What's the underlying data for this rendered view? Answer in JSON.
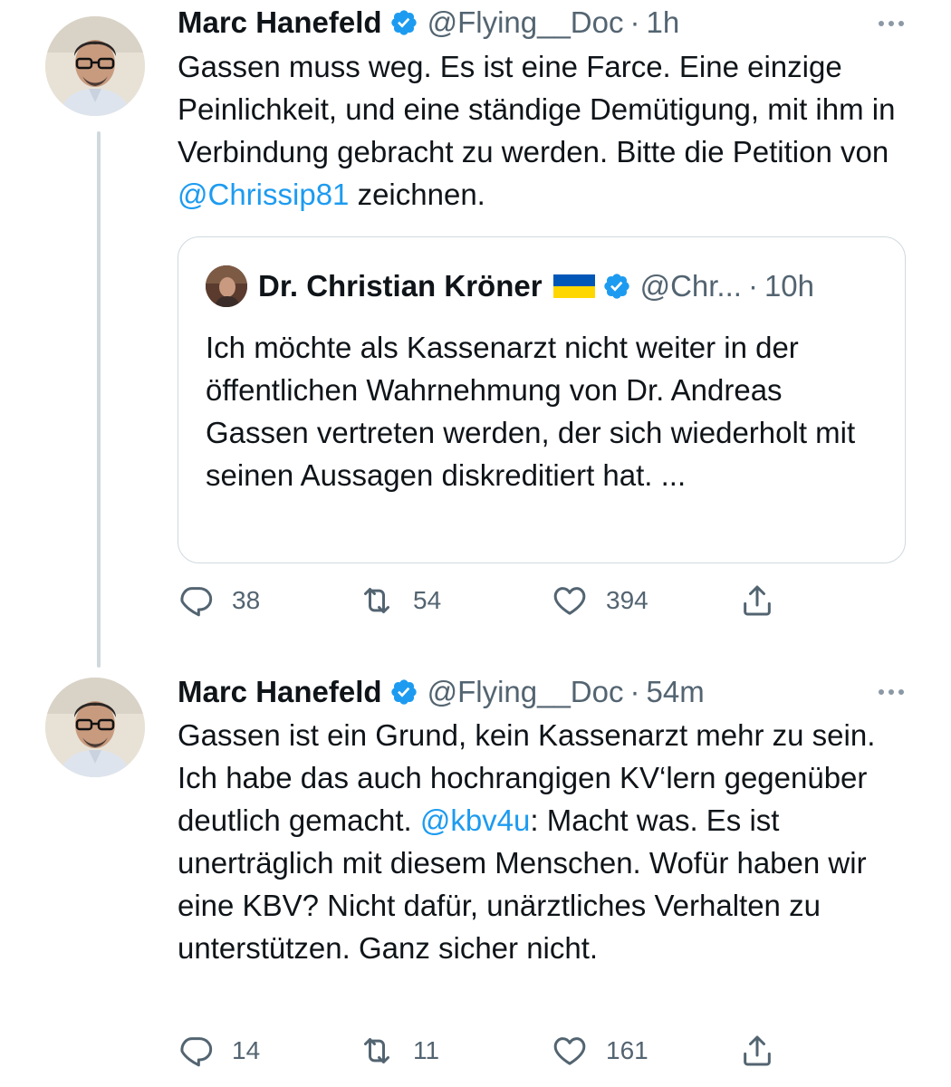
{
  "tweets": [
    {
      "author_name": "Marc Hanefeld",
      "handle": "@Flying__Doc",
      "separator": "·",
      "time": "1h",
      "text_before": "Gassen muss weg. Es ist eine Farce. Eine einzige Peinlichkeit, und eine ständige Demütigung, mit ihm in Verbindung gebracht zu werden. Bitte die Petition von ",
      "mention": "@Chrissip81",
      "text_after": " zeichnen.",
      "quote": {
        "author_name": "Dr. Christian Kröner",
        "handle": "@Chr...",
        "separator": "·",
        "time": "10h",
        "text": "Ich möchte als Kassenarzt nicht weiter in der öffentlichen Wahrnehmung von Dr. Andreas Gassen vertreten werden, der sich wiederholt mit seinen Aussagen diskreditiert hat. ..."
      },
      "replies": "38",
      "retweets": "54",
      "likes": "394"
    },
    {
      "author_name": "Marc Hanefeld",
      "handle": "@Flying__Doc",
      "separator": "·",
      "time": "54m",
      "text_before": "Gassen ist ein Grund, kein Kassenarzt mehr zu sein. Ich habe das auch hochrangigen KV‘lern gegenüber deutlich gemacht. ",
      "mention": "@kbv4u",
      "text_after": ": Macht was. Es ist unerträglich mit diesem Menschen. Wofür haben wir eine KBV? Nicht dafür, unärztliches Verhalten zu unterstützen. Ganz sicher nicht.",
      "replies": "14",
      "retweets": "11",
      "likes": "161"
    }
  ],
  "icons": {
    "verified": "verified-badge-icon",
    "more": "more-dots-icon",
    "reply": "reply-icon",
    "retweet": "retweet-icon",
    "like": "heart-icon",
    "share": "share-icon",
    "flag": "ukraine-flag-icon"
  },
  "colors": {
    "accent": "#1d9bf0",
    "text": "#0f1419",
    "secondary": "#536471",
    "border": "#cfd9de",
    "flag_blue": "#0057b7",
    "flag_yellow": "#ffd700"
  }
}
